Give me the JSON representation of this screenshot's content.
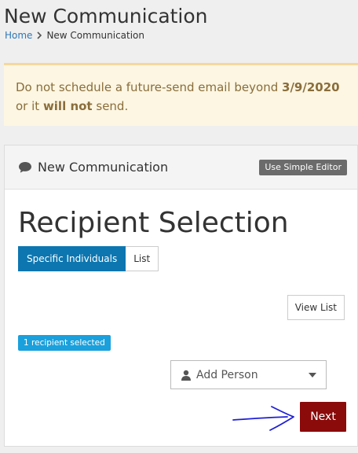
{
  "page": {
    "title": "New Communication"
  },
  "breadcrumb": {
    "home": "Home",
    "current": "New Communication"
  },
  "alert": {
    "text_before": "Do not schedule a future-send email beyond ",
    "date": "3/9/2020",
    "text_middle": " or it ",
    "emphasis": "will not",
    "text_after": " send."
  },
  "panel": {
    "heading_icon": "chat-icon",
    "heading": "New Communication",
    "simple_editor_label": "Use Simple Editor"
  },
  "recipient_selection": {
    "title": "Recipient Selection",
    "tabs": [
      {
        "label": "Specific Individuals",
        "active": true
      },
      {
        "label": "List",
        "active": false
      }
    ],
    "view_list_label": "View List",
    "badge": "1 recipient selected",
    "add_person_label": "Add Person",
    "add_person_icon": "person-icon",
    "next_label": "Next"
  },
  "colors": {
    "link": "#2f77b7",
    "alert_bg": "#fcf6e2",
    "alert_text": "#8a6d3b",
    "active_tab": "#0d76b0",
    "badge": "#1aa0dc",
    "next_button": "#8b0a0a",
    "annotation_arrow": "#1f1fd6"
  }
}
